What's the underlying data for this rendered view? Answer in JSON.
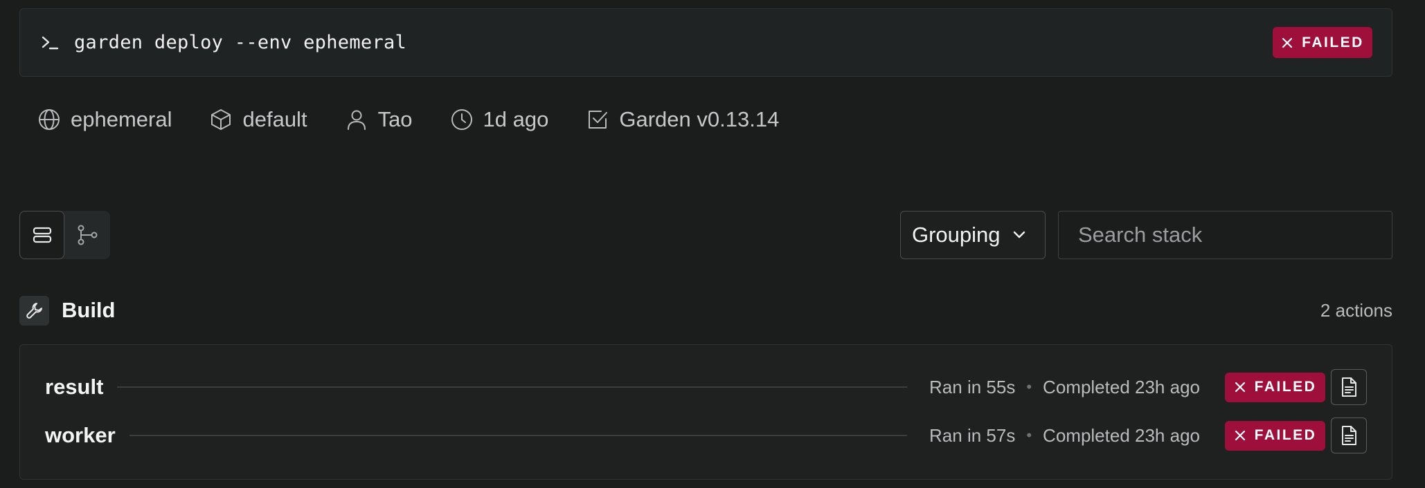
{
  "command": {
    "prompt_icon": "terminal-prompt-icon",
    "text": "garden deploy --env ephemeral",
    "status": "FAILED",
    "status_color": "#9e0f3c"
  },
  "meta": [
    {
      "icon": "globe-icon",
      "label": "ephemeral"
    },
    {
      "icon": "cube-icon",
      "label": "default"
    },
    {
      "icon": "user-icon",
      "label": "Tao"
    },
    {
      "icon": "clock-icon",
      "label": "1d ago"
    },
    {
      "icon": "checkbox-icon",
      "label": "Garden v0.13.14"
    }
  ],
  "toolbar": {
    "views": [
      {
        "icon": "list-view-icon",
        "active": true
      },
      {
        "icon": "graph-view-icon",
        "active": false
      }
    ],
    "grouping_label": "Grouping",
    "search_placeholder": "Search stack"
  },
  "section": {
    "icon": "wrench-icon",
    "title": "Build",
    "count": "2 actions"
  },
  "actions": [
    {
      "name": "result",
      "ran": "Ran in 55s",
      "completed": "Completed 23h ago",
      "status": "FAILED"
    },
    {
      "name": "worker",
      "ran": "Ran in 57s",
      "completed": "Completed 23h ago",
      "status": "FAILED"
    }
  ],
  "colors": {
    "background": "#1b1d1d",
    "failed": "#9e0f3c",
    "text_muted": "#b9bcbc"
  }
}
